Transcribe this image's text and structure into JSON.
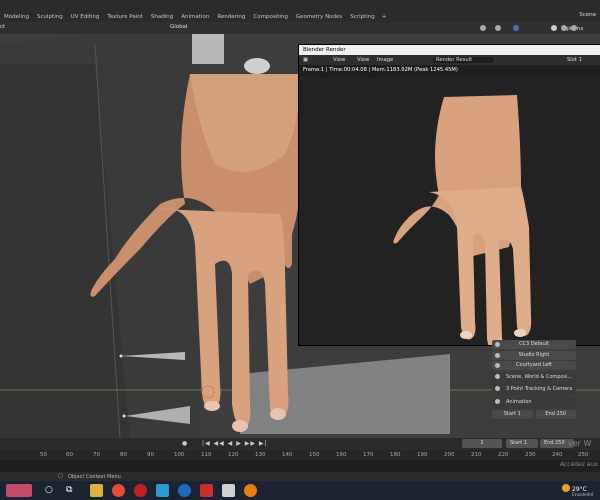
{
  "workspace_tabs": [
    "Modeling",
    "Sculpting",
    "UV Editing",
    "Texture Paint",
    "Shading",
    "Animation",
    "Rendering",
    "Compositing",
    "Geometry Nodes",
    "Scripting",
    "+"
  ],
  "scene_label": "Scene",
  "header": {
    "left_fragment": "ct",
    "orientation": "Global",
    "options": "Options"
  },
  "render_window": {
    "title": "Blender Render",
    "menu": [
      "View",
      "View",
      "Image"
    ],
    "result": "Render Result",
    "slot": "Slot 1",
    "info": "Frame:1 | Time:00:04.08 | Mem:1183.92M (Peak 1245.45M)"
  },
  "panel": {
    "buttons": [
      "CC3 Default",
      "Studio Right",
      "Courtyard Left"
    ],
    "big_buttons": [
      "Scene, World & Composi...",
      "3 Point Tracking & Camera",
      "Animation"
    ],
    "start_label": "Start",
    "start_value": "1",
    "end_label": "End",
    "end_value": "250"
  },
  "timeline": {
    "current_frame": "1",
    "start_label": "Start",
    "start_value": "1",
    "end_label": "End",
    "end_value": "250",
    "ruler": [
      "50",
      "60",
      "70",
      "80",
      "90",
      "100",
      "110",
      "120",
      "130",
      "140",
      "150",
      "160",
      "170",
      "180",
      "190",
      "200",
      "210",
      "220",
      "230",
      "240",
      "250"
    ]
  },
  "watermark": [
    "ver W",
    "Accédez aux"
  ],
  "status": {
    "context_menu": "Object Context Menu"
  },
  "taskbar": {
    "weather": "29°C",
    "weather_desc": "Ensoleillé"
  },
  "colors": {
    "skin": "#d9a27f",
    "skin_shade": "#b07a58",
    "render_bg": "#222222",
    "viewport_bg": "#3d3d3d",
    "accent": "#4772b3"
  }
}
